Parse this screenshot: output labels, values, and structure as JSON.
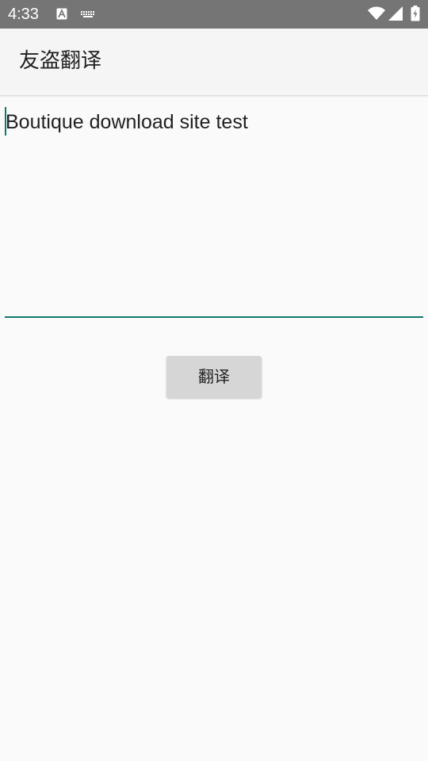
{
  "status_bar": {
    "time": "4:33",
    "icons": {
      "left": [
        "a-notification-icon",
        "keyboard-icon"
      ],
      "right": [
        "wifi-icon",
        "signal-icon",
        "battery-charging-icon"
      ]
    },
    "colors": {
      "background": "#757575",
      "foreground": "#ffffff"
    }
  },
  "app_bar": {
    "title": "友盗翻译"
  },
  "editor": {
    "text": "Boutique download site test",
    "underline_color": "#0f7a6c"
  },
  "actions": {
    "translate_label": "翻译"
  }
}
